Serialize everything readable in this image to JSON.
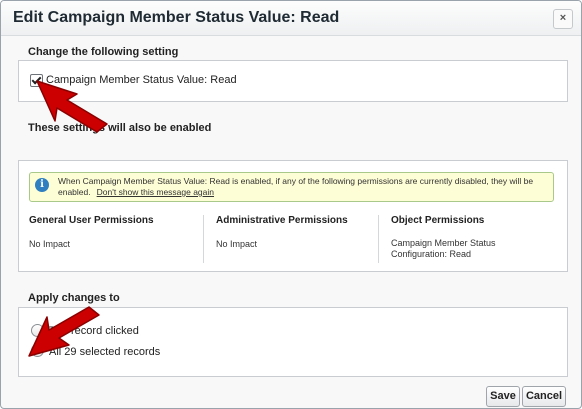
{
  "dialog": {
    "title": "Edit Campaign Member Status Value: Read",
    "close_icon": "×"
  },
  "change_section": {
    "heading": "Change the following setting",
    "checkbox_label": "Campaign Member Status Value: Read",
    "checked": true
  },
  "enabled_section": {
    "heading": "These settings will also be enabled",
    "info_message": "When Campaign Member Status Value: Read is enabled, if any of the following permissions are currently disabled, they will be enabled.",
    "info_link": "Don't show this message again",
    "columns": [
      {
        "header": "General User Permissions",
        "value": "No Impact"
      },
      {
        "header": "Administrative Permissions",
        "value": "No Impact"
      },
      {
        "header": "Object Permissions",
        "value": "Campaign Member Status Configuration: Read"
      }
    ]
  },
  "apply_section": {
    "heading": "Apply changes to",
    "options": [
      {
        "label": "The record clicked",
        "selected": false
      },
      {
        "label": "All 29 selected records",
        "selected": true
      }
    ]
  },
  "buttons": {
    "save": "Save",
    "cancel": "Cancel"
  },
  "colors": {
    "arrow": "#cc0000",
    "info_icon": "#2f7fc1",
    "info_bg": "#fefed6"
  }
}
